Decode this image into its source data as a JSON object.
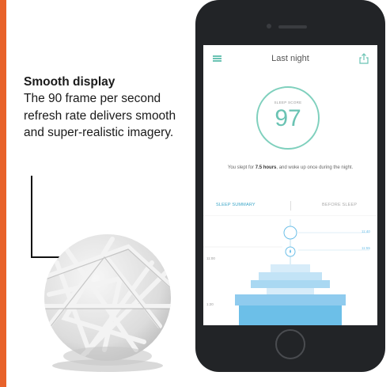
{
  "callout": {
    "title": "Smooth display",
    "body": "The 90 frame per second refresh rate delivers smooth and super-realistic imagery."
  },
  "app": {
    "title": "Last night",
    "score_label": "SLEEP SCORE",
    "score_value": "97",
    "summary_prefix": "You slept for ",
    "summary_hours": "7.5 hours",
    "summary_suffix": ", and woke up once during the night.",
    "tabs": [
      "SLEEP SUMMARY",
      "BEFORE SLEEP"
    ],
    "graph_times": [
      "11:00",
      "11:40",
      "11:55"
    ],
    "graph_left_label": "1:20"
  },
  "colors": {
    "accent": "#6ac3b3",
    "tab_active": "#3aa5c7",
    "graph_bar": "#a9d8f2",
    "graph_bar_dark": "#6cbfe8",
    "edge": "#e8622a"
  }
}
